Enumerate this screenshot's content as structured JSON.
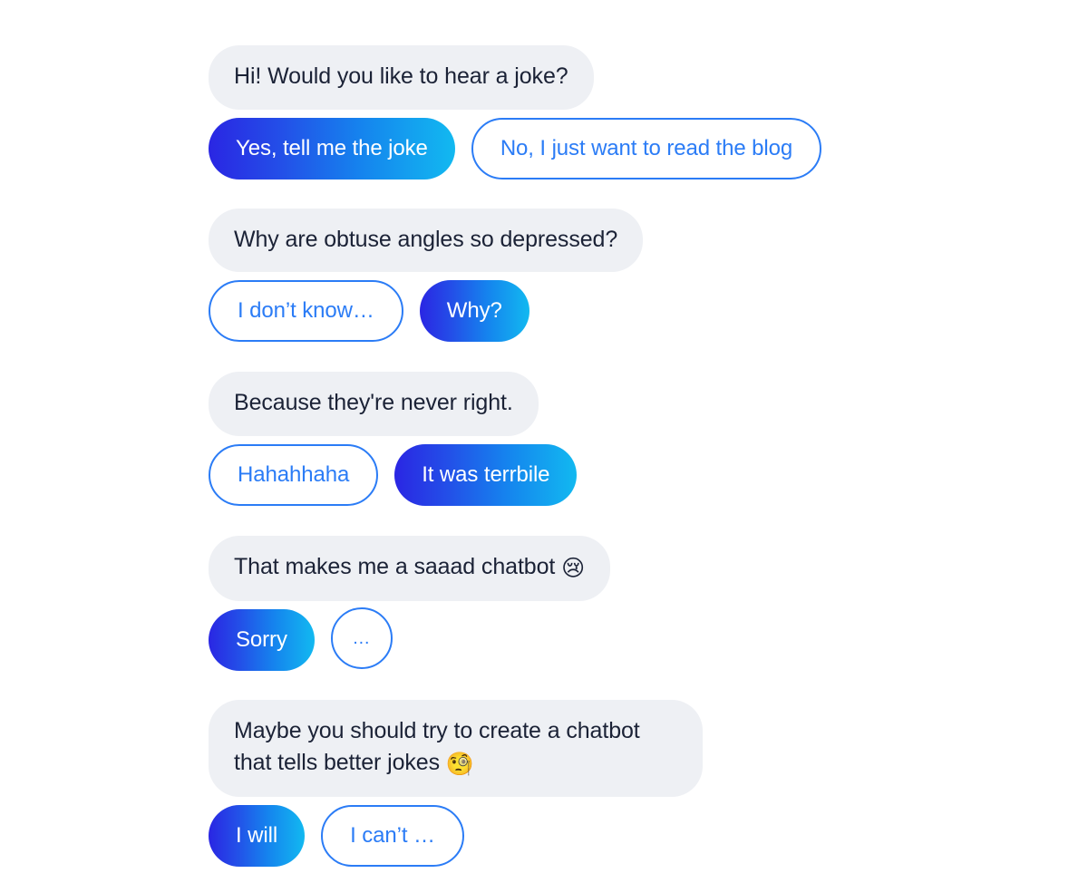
{
  "page": {
    "background_color": "#ffffff",
    "bot_bubble_color": "#eef0f4",
    "bot_text_color": "#1b2236",
    "accent_blue": "#2b7cf6",
    "gradient_start": "#2a26e3",
    "gradient_end": "#12b9f0"
  },
  "conversation": {
    "groups": [
      {
        "bot_message": "Hi! Would you like to hear a joke?",
        "emoji": "",
        "options": [
          {
            "label": "Yes, tell me the joke",
            "style": "filled"
          },
          {
            "label": "No, I just want to read the blog",
            "style": "outline"
          }
        ]
      },
      {
        "bot_message": "Why are obtuse angles so depressed?",
        "emoji": "",
        "options": [
          {
            "label": "I don’t know…",
            "style": "outline"
          },
          {
            "label": "Why?",
            "style": "filled"
          }
        ]
      },
      {
        "bot_message": "Because they're never right.",
        "emoji": "",
        "options": [
          {
            "label": "Hahahhaha",
            "style": "outline"
          },
          {
            "label": "It was terrbile",
            "style": "filled"
          }
        ]
      },
      {
        "bot_message": "That makes me a saaad chatbot ",
        "emoji": "😢",
        "emoji_name": "crying-face-emoji",
        "options": [
          {
            "label": "Sorry",
            "style": "filled"
          },
          {
            "label": "…",
            "style": "outline-circle"
          }
        ]
      },
      {
        "bot_message": "Maybe you should try to create a chatbot that tells better jokes ",
        "emoji": "🧐",
        "emoji_name": "monocle-face-emoji",
        "options": [
          {
            "label": "I will",
            "style": "filled"
          },
          {
            "label": "I can’t …",
            "style": "outline"
          }
        ]
      }
    ]
  }
}
